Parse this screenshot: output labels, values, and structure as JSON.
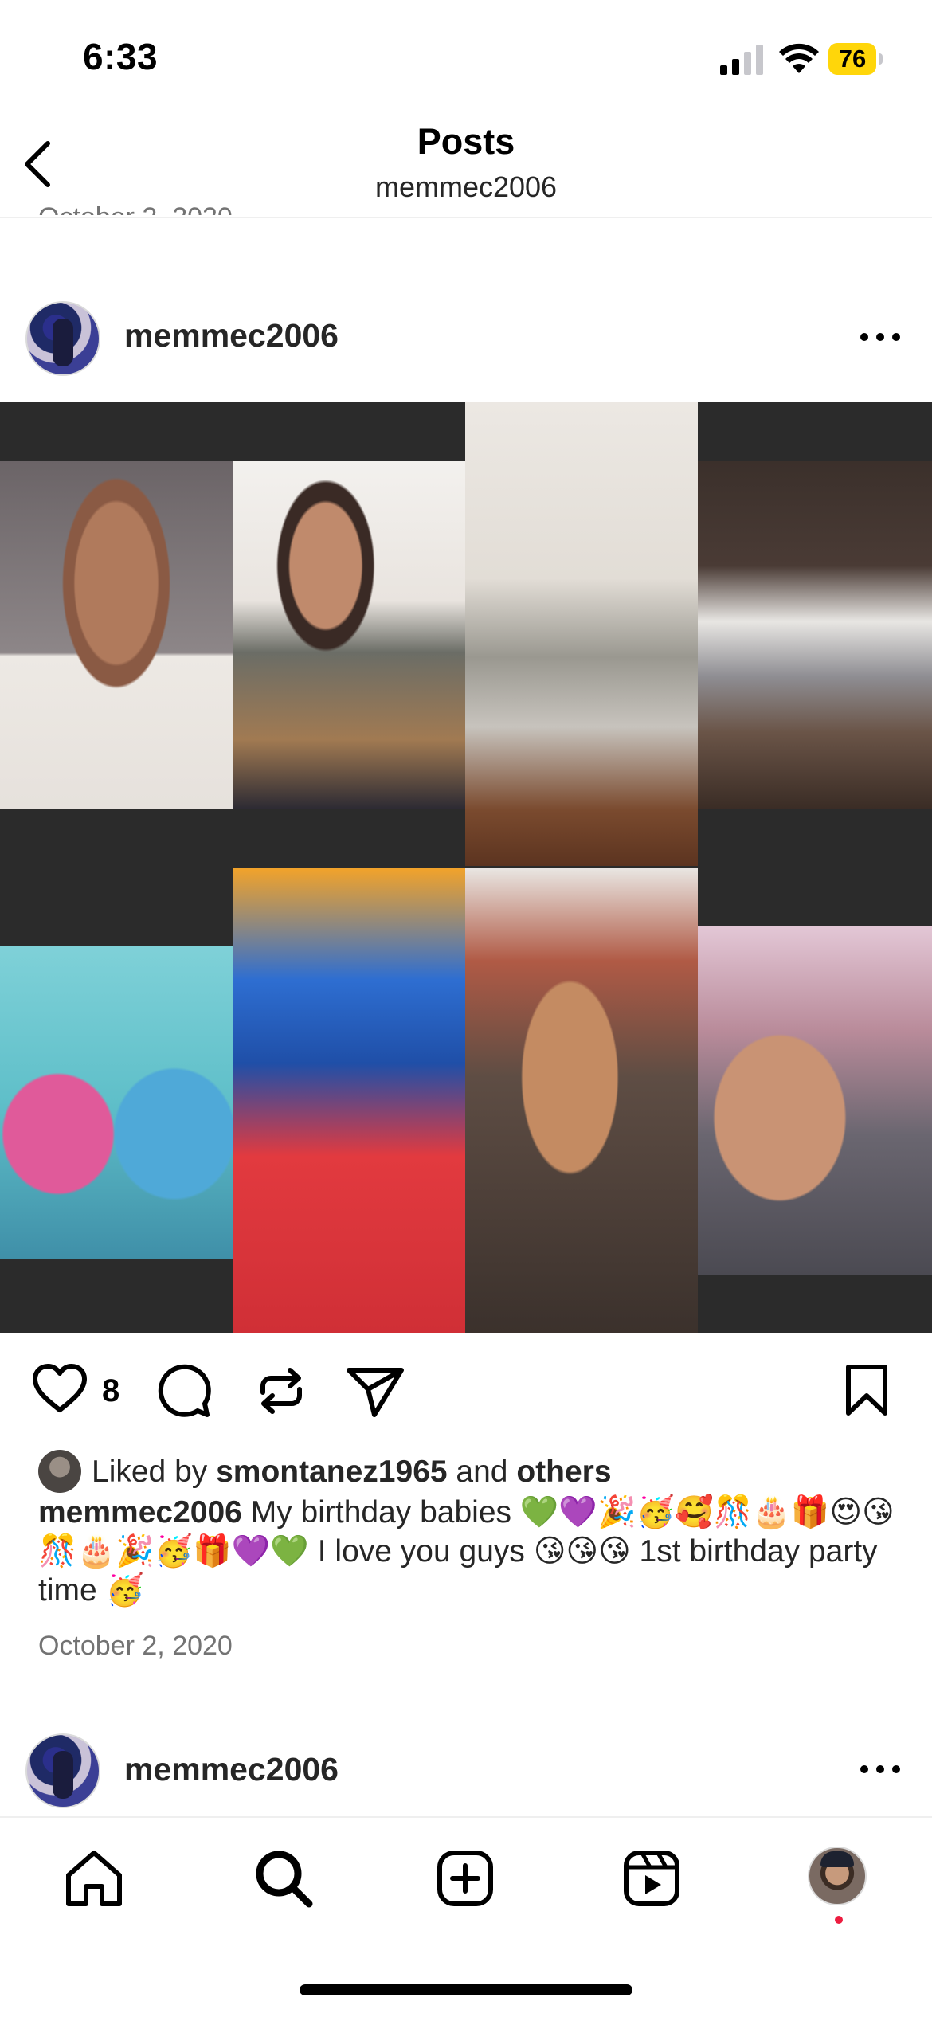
{
  "status_bar": {
    "time": "6:33",
    "battery": "76"
  },
  "header": {
    "title": "Posts",
    "subtitle": "memmec2006",
    "prev_date_partial": "October 2, 2020"
  },
  "post": {
    "username": "memmec2006",
    "like_count": "8",
    "liked_by_prefix": "Liked by ",
    "liked_by_user": "smontanez1965",
    "liked_by_mid": " and ",
    "liked_by_others": "others",
    "caption_user": "memmec2006",
    "caption_text": " My birthday babies 💚💜🎉🥳🥰🎊🎂🎁😍😘🎊🎂🎉🥳🎁💜💚 I love you guys 😘😘😘 1st birthday party time 🥳",
    "date": "October 2, 2020"
  },
  "next_post": {
    "username": "memmec2006"
  },
  "icons": {
    "back": "chevron-left-icon",
    "more": "more-horizontal-icon",
    "like": "heart-icon",
    "comment": "comment-icon",
    "repost": "repost-icon",
    "share": "send-icon",
    "save": "bookmark-icon",
    "home": "home-icon",
    "search": "search-icon",
    "create": "plus-square-icon",
    "reels": "reels-icon"
  },
  "colors": {
    "text_secondary": "#737373",
    "notification": "#ed1c3f",
    "battery": "#ffd60a"
  }
}
